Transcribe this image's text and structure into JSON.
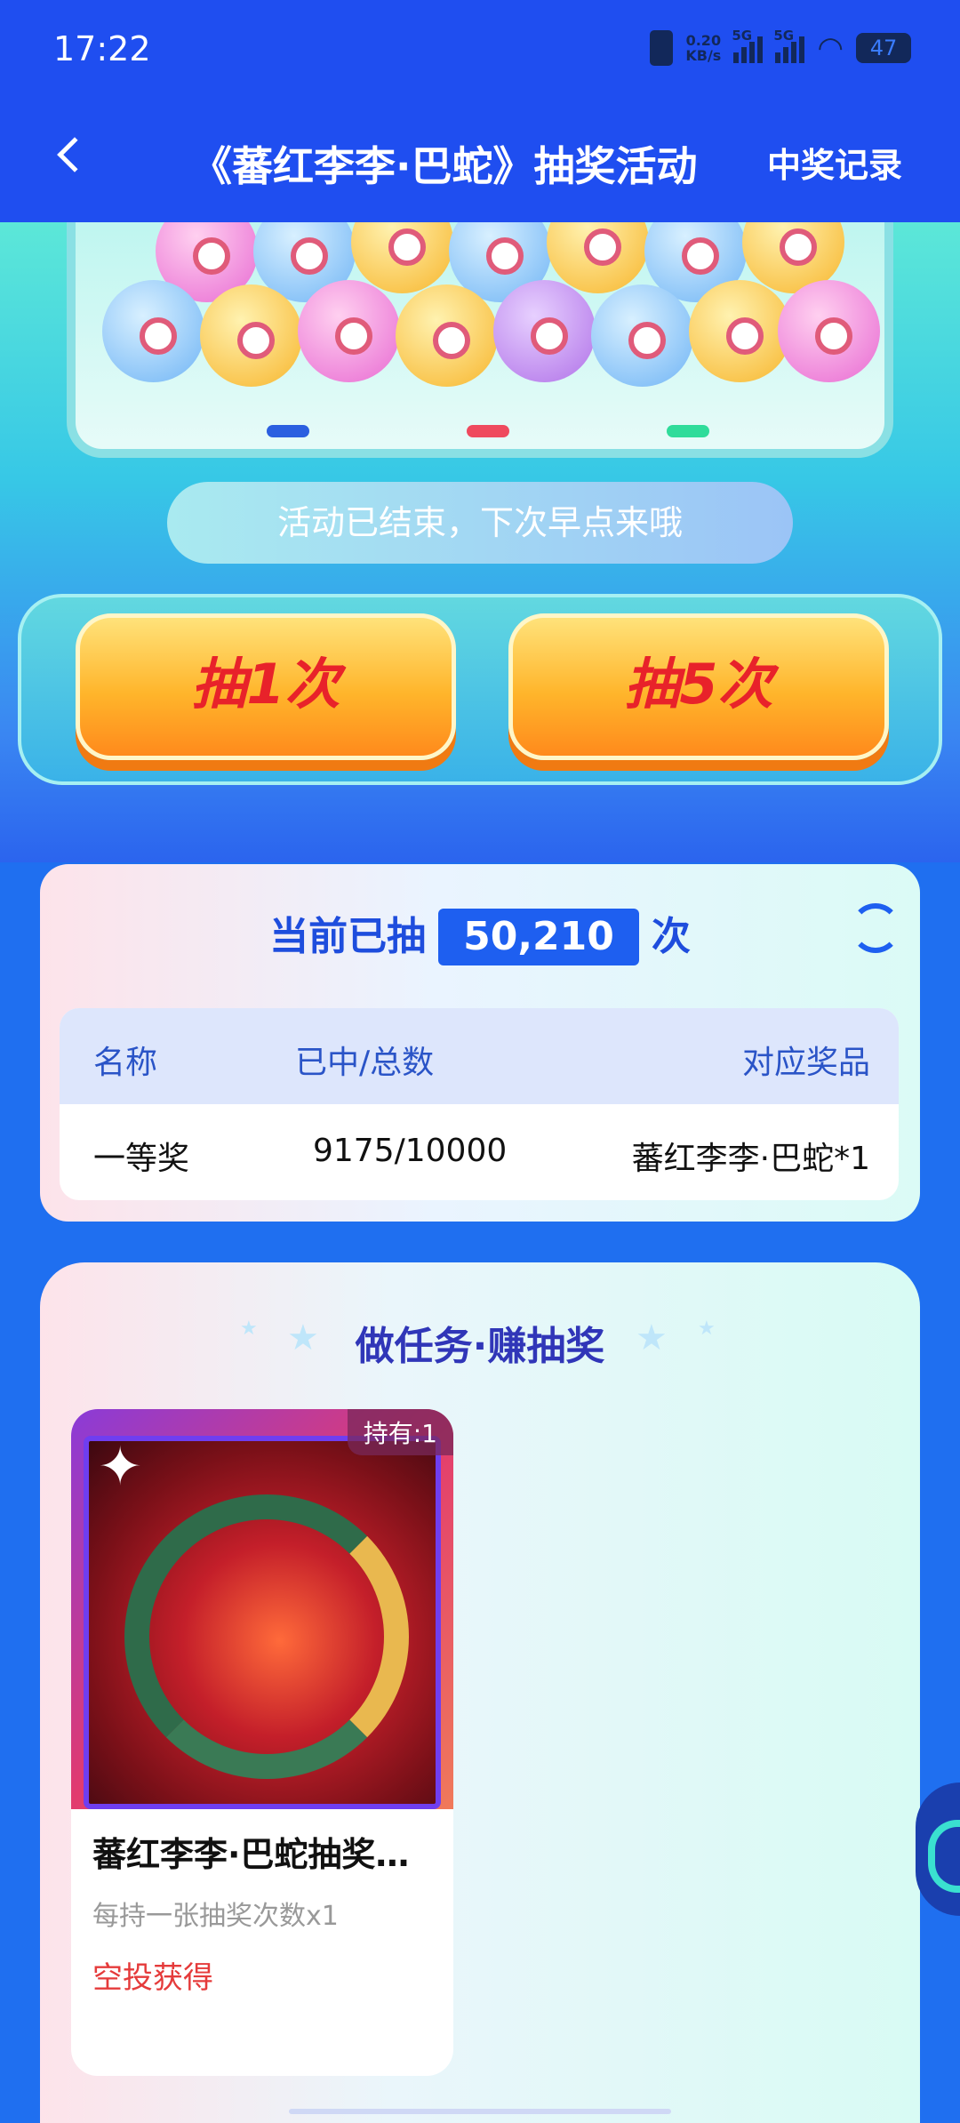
{
  "status": {
    "time": "17:22",
    "net_speed": "0.20",
    "net_unit": "KB/s",
    "sig1": "5G",
    "sig2": "5G",
    "battery": "47"
  },
  "header": {
    "title": "《蕃红李李·巴蛇》抽奖活动",
    "record": "中奖记录"
  },
  "machine": {
    "notice": "活动已结束，下次早点来哦",
    "draw1": "抽1次",
    "draw5": "抽5次"
  },
  "stats": {
    "prefix": "当前已抽",
    "count": "50,210",
    "suffix": "次",
    "columns": {
      "name": "名称",
      "progress": "已中/总数",
      "prize": "对应奖品"
    },
    "rows": [
      {
        "name": "一等奖",
        "progress": "9175/10000",
        "prize": "蕃红李李·巴蛇*1"
      }
    ]
  },
  "task": {
    "title": "做任务·赚抽奖",
    "item": {
      "hold": "持有:1",
      "name": "蕃红李李·巴蛇抽奖…",
      "desc": "每持一张抽奖次数x1",
      "source": "空投获得"
    }
  },
  "colors": {
    "primary": "#1f4ef0",
    "accent_red": "#e53b3b",
    "button_orange": "#ffb52b"
  }
}
